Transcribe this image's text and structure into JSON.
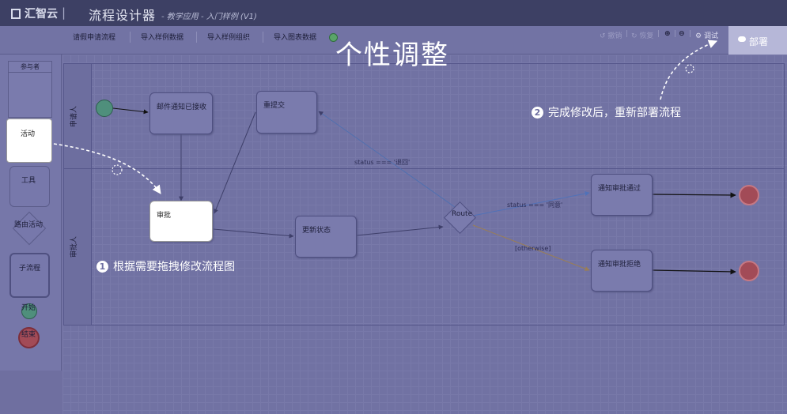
{
  "app": {
    "logo_text": "汇智云",
    "title": "流程设计器",
    "subtitle": "- 教学应用 - 入门样例 (V1)"
  },
  "toolbar": {
    "items": [
      "请假申请流程",
      "导入样例数据",
      "导入样例组织",
      "导入图表数据"
    ],
    "undo": "撤销",
    "redo": "恢复",
    "zoom_in_icon": "zoom-in-icon",
    "zoom_out_icon": "zoom-out-icon",
    "debug": "调试",
    "deploy": "部署"
  },
  "overlay_title": "个性调整",
  "palette": {
    "participant": "参与者",
    "activity": "活动",
    "tool": "工具",
    "route": "路由活动",
    "subprocess": "子流程",
    "start": "开始",
    "end": "结束"
  },
  "lanes": [
    "申请人",
    "审批人"
  ],
  "nodes": {
    "email_received": "邮件通知已接收",
    "resubmit": "重提交",
    "approve": "审批",
    "update_status": "更新状态",
    "route": "Route",
    "notify_pass": "通知审批通过",
    "notify_reject": "通知审批拒绝"
  },
  "edges": {
    "returned": "status === '退回'",
    "agreed": "status === '同意'",
    "otherwise": "[otherwise]"
  },
  "hints": {
    "step1_num": "1",
    "step1": "根据需要拖拽修改流程图",
    "step2_num": "2",
    "step2": "完成修改后，重新部署流程"
  },
  "colors": {
    "topbar": "#3d4064",
    "overlay": "#6f6fa0",
    "start": "#4f8f7c",
    "end": "#a24b57"
  }
}
